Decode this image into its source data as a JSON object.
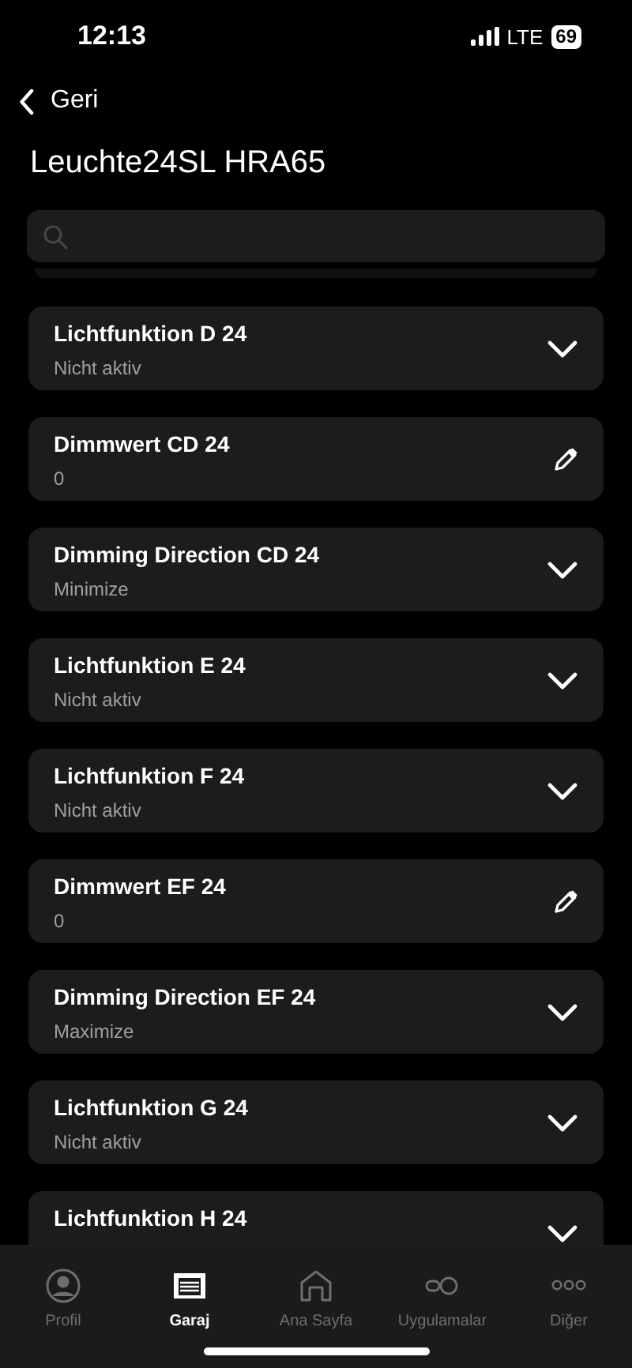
{
  "status_bar": {
    "time": "12:13",
    "network": "LTE",
    "battery": "69"
  },
  "nav": {
    "back": "Geri",
    "title": "Leuchte24SL HRA65"
  },
  "items": [
    {
      "kind": "select",
      "title": "Lichtfunktion D 24",
      "value": "Nicht aktiv"
    },
    {
      "kind": "edit",
      "title": "Dimmwert CD 24",
      "value": "0"
    },
    {
      "kind": "select",
      "title": "Dimming Direction CD 24",
      "value": "Minimize"
    },
    {
      "kind": "select",
      "title": "Lichtfunktion E 24",
      "value": "Nicht aktiv"
    },
    {
      "kind": "select",
      "title": "Lichtfunktion F 24",
      "value": "Nicht aktiv"
    },
    {
      "kind": "edit",
      "title": "Dimmwert EF 24",
      "value": "0"
    },
    {
      "kind": "select",
      "title": "Dimming Direction EF 24",
      "value": "Maximize"
    },
    {
      "kind": "select",
      "title": "Lichtfunktion G 24",
      "value": "Nicht aktiv"
    },
    {
      "kind": "select",
      "title": "Lichtfunktion H 24"
    }
  ],
  "tabs": [
    {
      "kind": "profile",
      "label": "Profil",
      "selected": false
    },
    {
      "kind": "garage",
      "label": "Garaj",
      "selected": true
    },
    {
      "kind": "home",
      "label": "Ana Sayfa",
      "selected": false
    },
    {
      "kind": "apps",
      "label": "Uygulamalar",
      "selected": false
    },
    {
      "kind": "more",
      "label": "Diğer",
      "selected": false
    }
  ]
}
